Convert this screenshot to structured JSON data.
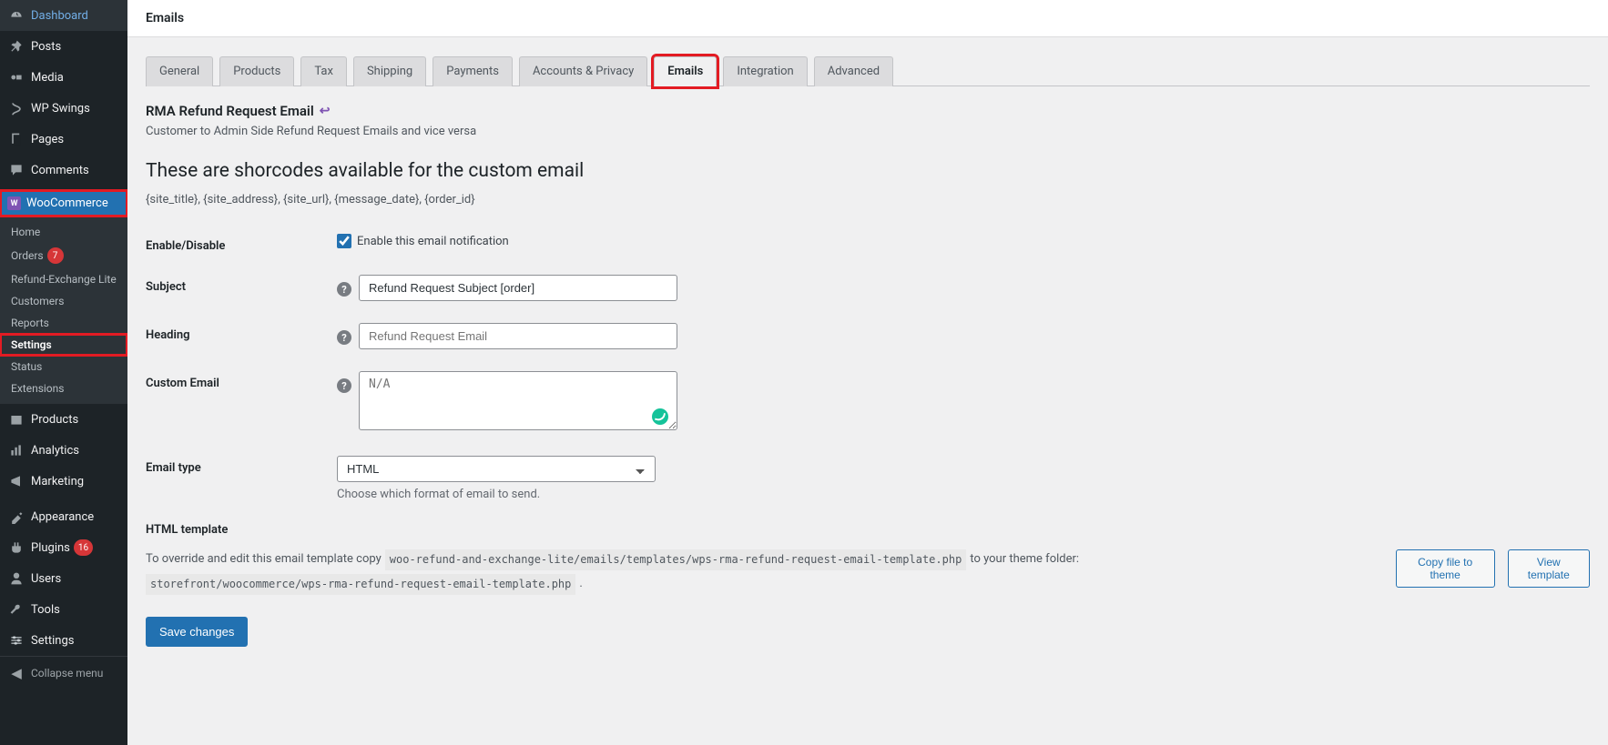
{
  "sidebar": {
    "items": [
      {
        "icon": "⏲",
        "label": "Dashboard"
      },
      {
        "icon": "📌",
        "label": "Posts"
      },
      {
        "icon": "🎵",
        "label": "Media"
      },
      {
        "icon": "🔗",
        "label": "WP Swings"
      },
      {
        "icon": "📄",
        "label": "Pages"
      },
      {
        "icon": "💬",
        "label": "Comments"
      }
    ],
    "woo": {
      "label": "WooCommerce"
    },
    "submenu": [
      {
        "label": "Home"
      },
      {
        "label": "Orders",
        "badge": "7"
      },
      {
        "label": "Refund-Exchange Lite"
      },
      {
        "label": "Customers"
      },
      {
        "label": "Reports"
      },
      {
        "label": "Settings",
        "current": true
      },
      {
        "label": "Status"
      },
      {
        "label": "Extensions"
      }
    ],
    "items2": [
      {
        "icon": "📦",
        "label": "Products"
      },
      {
        "icon": "📊",
        "label": "Analytics"
      },
      {
        "icon": "📢",
        "label": "Marketing"
      }
    ],
    "items3": [
      {
        "icon": "🖌",
        "label": "Appearance"
      },
      {
        "icon": "🔌",
        "label": "Plugins",
        "badge": "16"
      },
      {
        "icon": "👤",
        "label": "Users"
      },
      {
        "icon": "🔧",
        "label": "Tools"
      },
      {
        "icon": "⚙",
        "label": "Settings"
      }
    ],
    "collapse": "Collapse menu"
  },
  "header": {
    "title": "Emails"
  },
  "tabs": [
    "General",
    "Products",
    "Tax",
    "Shipping",
    "Payments",
    "Accounts & Privacy",
    "Emails",
    "Integration",
    "Advanced"
  ],
  "active_tab": "Emails",
  "section": {
    "title": "RMA Refund Request Email",
    "desc": "Customer to Admin Side Refund Request Emails and vice versa",
    "shortcodes_title": "These are shorcodes available for the custom email",
    "shortcodes_list": "{site_title}, {site_address}, {site_url}, {message_date}, {order_id}"
  },
  "form": {
    "enable_label": "Enable/Disable",
    "enable_checkbox_label": "Enable this email notification",
    "enable_checked": true,
    "subject_label": "Subject",
    "subject_value": "Refund Request Subject [order]",
    "heading_label": "Heading",
    "heading_placeholder": "Refund Request Email",
    "custom_email_label": "Custom Email",
    "custom_email_placeholder": "N/A",
    "email_type_label": "Email type",
    "email_type_value": "HTML",
    "email_type_desc": "Choose which format of email to send."
  },
  "template": {
    "title": "HTML template",
    "prefix": "To override and edit this email template copy",
    "path1": "woo-refund-and-exchange-lite/emails/templates/wps-rma-refund-request-email-template.php",
    "middle": "to your theme folder:",
    "path2": "storefront/woocommerce/wps-rma-refund-request-email-template.php",
    "suffix": ".",
    "copy_btn": "Copy file to theme",
    "view_btn": "View template"
  },
  "save_btn": "Save changes"
}
